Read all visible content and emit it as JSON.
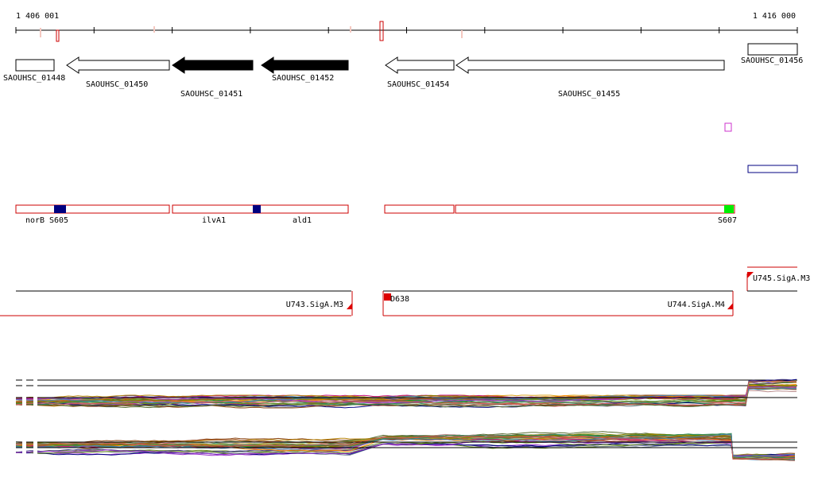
{
  "ruler": {
    "start": "1 406 001",
    "end": "1 416 000"
  },
  "genes": [
    {
      "label": "SAOUHSC_01448"
    },
    {
      "label": "SAOUHSC_01450"
    },
    {
      "label": "SAOUHSC_01451"
    },
    {
      "label": "SAOUHSC_01452"
    },
    {
      "label": "SAOUHSC_01454"
    },
    {
      "label": "SAOUHSC_01455"
    },
    {
      "label": "SAOUHSC_01456"
    }
  ],
  "annotations": [
    {
      "label": "norB"
    },
    {
      "label": "S605"
    },
    {
      "label": "ilvA1"
    },
    {
      "label": "ald1"
    },
    {
      "label": "S607"
    }
  ],
  "segments": [
    {
      "label": "U743.SigA.M3"
    },
    {
      "label": "D638"
    },
    {
      "label": "U744.SigA.M4"
    },
    {
      "label": "U745.SigA.M3"
    }
  ],
  "colors": {
    "axis": "#000000",
    "gene_fill_reverse_dark": "#000000",
    "gene_outline": "#000000",
    "annotation_outline": "#cc0000",
    "feature_blue": "#000080",
    "feature_green": "#00ee00",
    "feature_magenta": "#cc33cc",
    "segment_red": "#dd0000"
  }
}
